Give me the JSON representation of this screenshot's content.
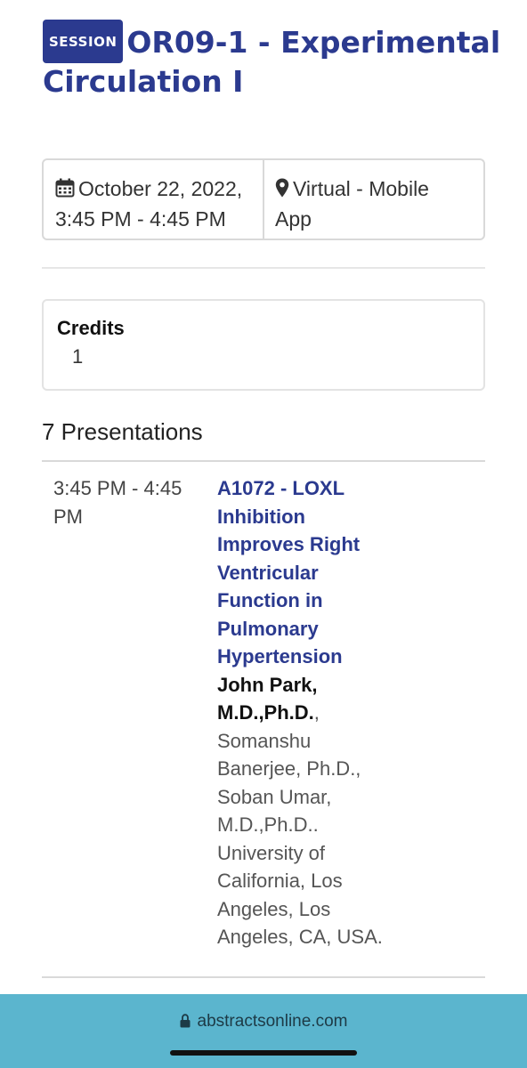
{
  "session": {
    "badge": "SESSION",
    "title": "OR09-1 - Experimental Circulation I"
  },
  "info": {
    "date_line1": "October 22, 2022,",
    "date_line2": "3:45 PM - 4:45 PM",
    "location_line1": "Virtual - Mobile",
    "location_line2": "App",
    "date_icon": "calendar-icon",
    "location_icon": "map-pin-icon"
  },
  "credits": {
    "title": "Credits",
    "value": "1"
  },
  "presentations": {
    "count_label": "7 Presentations",
    "items": [
      {
        "time_line1": "3:45 PM - 4:45",
        "time_line2": "PM",
        "title_lines": [
          "A1072 - LOXL",
          "Inhibition",
          "Improves Right",
          "Ventricular",
          "Function in",
          "Pulmonary",
          "Hypertension"
        ],
        "presenter_lines": [
          "John Park,",
          "M.D.,Ph.D."
        ],
        "presenter_suffix": ",",
        "author_lines": [
          "Somanshu",
          "Banerjee, Ph.D.,",
          "Soban Umar,",
          "M.D.,Ph.D..",
          "University of",
          "California, Los",
          "Angeles, Los",
          "Angeles, CA, USA."
        ]
      }
    ]
  },
  "browser": {
    "url": "abstractsonline.com",
    "lock_icon": "lock-icon"
  },
  "colors": {
    "brand": "#2b3a8f",
    "bottom_bar": "#5bb5ce"
  }
}
